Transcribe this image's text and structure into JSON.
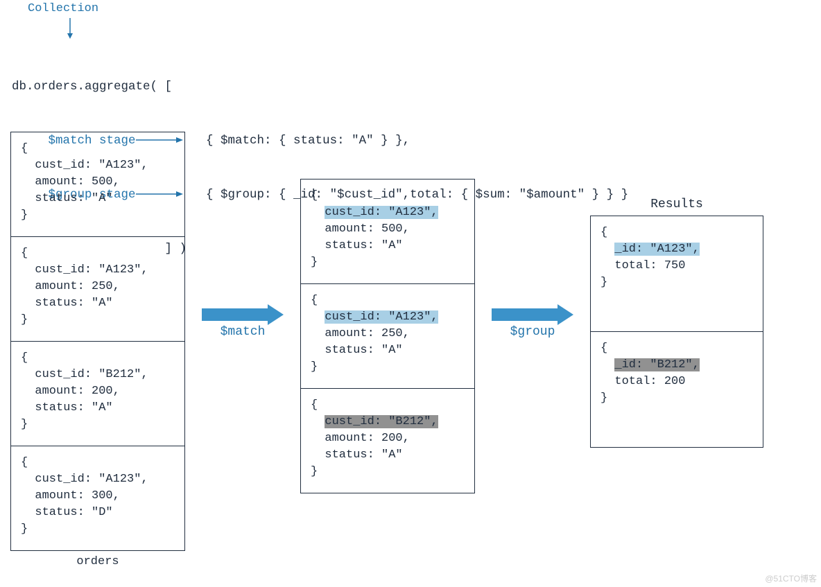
{
  "labels": {
    "collection": "Collection",
    "match_stage": "$match stage",
    "group_stage": "$group stage",
    "orders_title": "orders",
    "results_title": "Results",
    "match_arrow": "$match",
    "group_arrow": "$group",
    "watermark": "@51CTO博客"
  },
  "code": {
    "line1": "db.orders.aggregate( [",
    "line2_stage": "     $match stage",
    "line2_code": "   { $match: { status: \"A\" } },",
    "line3_stage": "     $group stage",
    "line3_code": "   { $group: { _id: \"$cust_id\",total: { $sum: \"$amount\" } } }",
    "line4": "                     ] )"
  },
  "orders": [
    {
      "open": "{",
      "l1": "  cust_id: \"A123\",",
      "l2": "  amount: 500,",
      "l3": "  status: \"A\"",
      "close": "}"
    },
    {
      "open": "{",
      "l1": "  cust_id: \"A123\",",
      "l2": "  amount: 250,",
      "l3": "  status: \"A\"",
      "close": "}"
    },
    {
      "open": "{",
      "l1": "  cust_id: \"B212\",",
      "l2": "  amount: 200,",
      "l3": "  status: \"A\"",
      "close": "}"
    },
    {
      "open": "{",
      "l1": "  cust_id: \"A123\",",
      "l2": "  amount: 300,",
      "l3": "  status: \"D\"",
      "close": "}"
    }
  ],
  "matched": [
    {
      "open": "{",
      "hl": "cust_id: \"A123\",",
      "hl_class": "hl-blue",
      "l2": "  amount: 500,",
      "l3": "  status: \"A\"",
      "close": "}"
    },
    {
      "open": "{",
      "hl": "cust_id: \"A123\",",
      "hl_class": "hl-blue",
      "l2": "  amount: 250,",
      "l3": "  status: \"A\"",
      "close": "}"
    },
    {
      "open": "{",
      "hl": "cust_id: \"B212\",",
      "hl_class": "hl-gray",
      "l2": "  amount: 200,",
      "l3": "  status: \"A\"",
      "close": "}"
    }
  ],
  "results": [
    {
      "open": "{",
      "hl": "_id: \"A123\",",
      "hl_class": "hl-blue",
      "l2": "  total: 750",
      "close": "}"
    },
    {
      "open": "{",
      "hl": "_id: \"B212\",",
      "hl_class": "hl-gray",
      "l2": "  total: 200",
      "close": "}"
    }
  ],
  "colors": {
    "accent": "#2374ab",
    "ink": "#212e3f",
    "hl_blue": "#a8cfe5",
    "hl_gray": "#919191",
    "arrow_fill": "#3b92c9"
  }
}
